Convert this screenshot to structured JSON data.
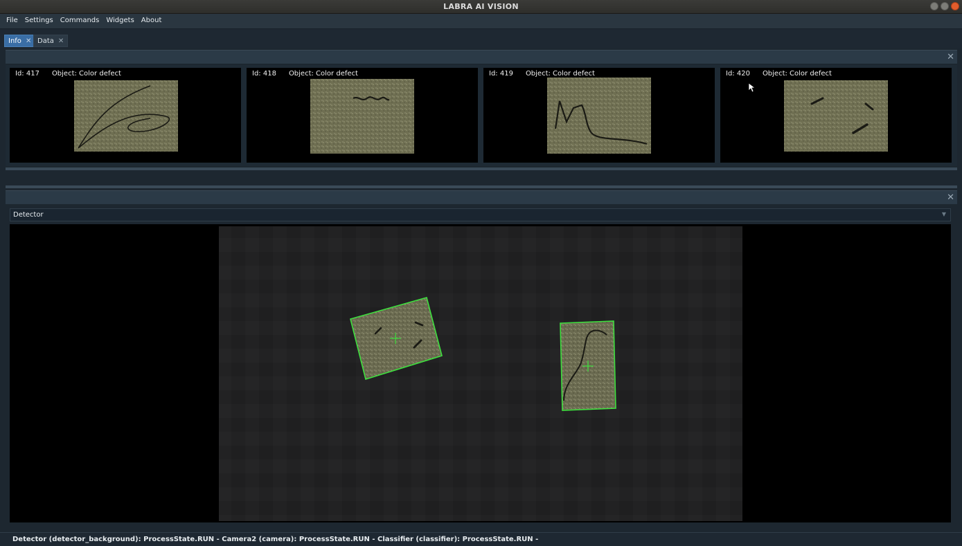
{
  "window": {
    "title": "LABRA AI VISION"
  },
  "menu": [
    "File",
    "Settings",
    "Commands",
    "Widgets",
    "About"
  ],
  "tabs": [
    {
      "label": "Info",
      "active": true
    },
    {
      "label": "Data",
      "active": false
    }
  ],
  "thumbnails": [
    {
      "id": "Id: 417",
      "object": "Object: Color defect"
    },
    {
      "id": "Id: 418",
      "object": "Object: Color defect"
    },
    {
      "id": "Id: 419",
      "object": "Object: Color defect"
    },
    {
      "id": "Id: 420",
      "object": "Object: Color defect"
    }
  ],
  "detector": {
    "selected": "Detector"
  },
  "status": "Detector (detector_background): ProcessState.RUN - Camera2 (camera): ProcessState.RUN - Classifier (classifier): ProcessState.RUN -",
  "colors": {
    "accent": "#3a6ea5",
    "detection": "#3ee03e",
    "sample": "#7a7a5c"
  },
  "icons": [
    "close-icon",
    "chevron-down-icon",
    "minimize-icon",
    "maximize-icon",
    "crosshair-icon",
    "cursor-icon"
  ]
}
